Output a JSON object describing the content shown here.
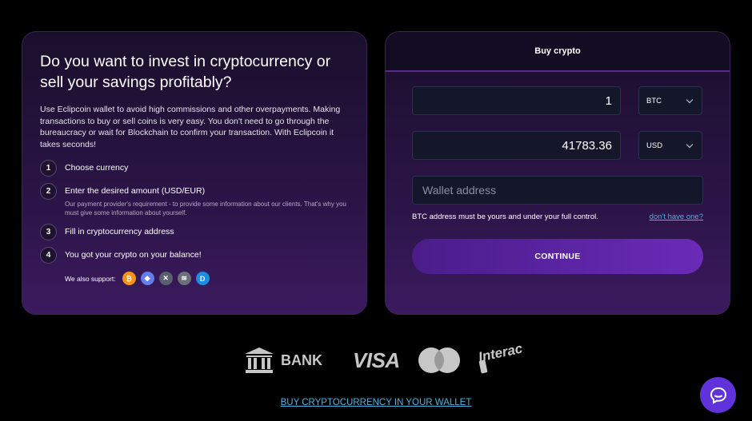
{
  "info": {
    "heading": "Do you want to invest in cryptocurrency or sell your savings profitably?",
    "description": "Use Eclipcoin wallet to avoid high commissions and other overpayments. Making transactions to buy or sell coins is very easy. You don't need to go through the bureaucracy or wait for Blockchain to confirm your transaction. With Eclipcoin it takes seconds!",
    "steps": [
      {
        "num": "1",
        "title": "Choose currency",
        "note": ""
      },
      {
        "num": "2",
        "title": "Enter the desired amount (USD/EUR)",
        "note": "Our payment provider's requirement - to provide some information about our clients. That's why you must give some information about yourself."
      },
      {
        "num": "3",
        "title": "Fill in cryptocurrency address",
        "note": ""
      },
      {
        "num": "4",
        "title": "You got your crypto on your balance!",
        "note": ""
      }
    ],
    "support_label": "We also support:",
    "coins": [
      {
        "name": "bitcoin",
        "glyph": "₿",
        "color": "#f7931a"
      },
      {
        "name": "ethereum",
        "glyph": "◆",
        "color": "#627eea"
      },
      {
        "name": "xrp",
        "glyph": "✕",
        "color": "#5a5f6e"
      },
      {
        "name": "stellar",
        "glyph": "≋",
        "color": "#6b6f7a"
      },
      {
        "name": "dash",
        "glyph": "D",
        "color": "#1c8de2"
      }
    ]
  },
  "buy": {
    "title": "Buy crypto",
    "crypto_amount": "1",
    "crypto_currency": "BTC",
    "fiat_amount": "41783.36",
    "fiat_currency": "USD",
    "wallet_placeholder": "Wallet address",
    "note": "BTC address must be yours and under your full control.",
    "no_wallet_link": "don't have one?",
    "continue_label": "CONTINUE"
  },
  "payments": {
    "bank_label": "BANK",
    "visa_label": "VISA",
    "interac_label": "Interac"
  },
  "bottom_link": "BUY CRYPTOCURRENCY IN YOUR WALLET",
  "colors": {
    "accent": "#5f33d9",
    "link": "#4ab3e0",
    "button": "#5a26a0"
  }
}
